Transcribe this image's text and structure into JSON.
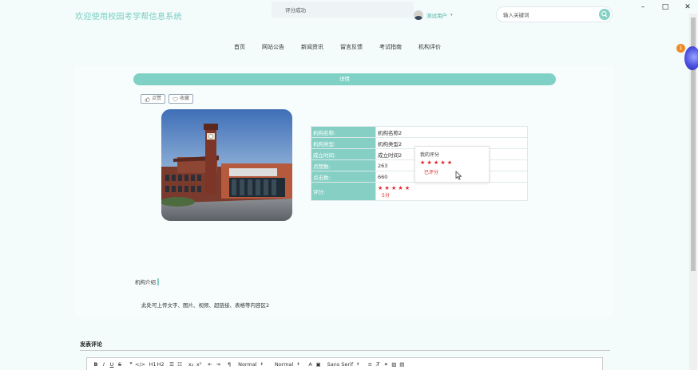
{
  "window": {
    "minimize": "–",
    "maximize": "□",
    "close": "✕"
  },
  "header": {
    "site_title": "欢迎使用校园考学帮信息系统",
    "toast": "评分成功",
    "user_name": "测试用户",
    "search_placeholder": "输入关键词"
  },
  "nav": [
    "首页",
    "网站公告",
    "新闻资讯",
    "留言反馈",
    "考试指南",
    "机构评价"
  ],
  "badge_count": "1",
  "detail": {
    "title": "详情",
    "like_label": "点赞",
    "collect_label": "收藏",
    "fields": [
      {
        "key": "机构名称:",
        "value": "机构名称2"
      },
      {
        "key": "机构类型:",
        "value": "机构类型2"
      },
      {
        "key": "成立时间:",
        "value": "成立时间2"
      },
      {
        "key": "点赞数:",
        "value": "263"
      },
      {
        "key": "点击数:",
        "value": "660"
      }
    ],
    "rating_key": "评分:",
    "rating_stars": "★★★★★",
    "rating_text": "5分"
  },
  "my_rating": {
    "title": "我的评分",
    "stars": "★★★★★",
    "status": "已评分"
  },
  "intro": {
    "title": "机构介绍",
    "text": "此处可上传文字、图片、视频、超链接、表格等内容区2"
  },
  "comment": {
    "title": "发表评论",
    "toolbar": [
      "B",
      "I",
      "U",
      "S",
      "❞",
      "</>",
      "H1",
      "H2",
      "☰",
      "☷",
      "x₂",
      "x²",
      "⇤",
      "⇥",
      "¶"
    ],
    "selects": [
      "Normal",
      "Normal"
    ],
    "font_select": "Sans Serif",
    "colors": {
      "accent": "#80d1c5",
      "star": "#e0242c",
      "title": "#78cfc3"
    }
  }
}
